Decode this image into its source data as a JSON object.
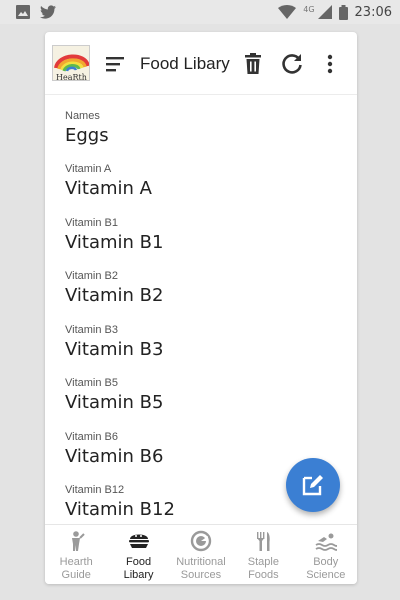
{
  "status_bar": {
    "network": "4G",
    "time": "23:06"
  },
  "toolbar": {
    "title": "Food Libary",
    "logo_text": "HeaRth"
  },
  "fields": [
    {
      "label": "Names",
      "value": "Eggs"
    },
    {
      "label": "Vitamin A",
      "value": "Vitamin A"
    },
    {
      "label": "Vitamin B1",
      "value": "Vitamin B1"
    },
    {
      "label": "Vitamin B2",
      "value": "Vitamin B2"
    },
    {
      "label": "Vitamin B3",
      "value": "Vitamin B3"
    },
    {
      "label": "Vitamin B5",
      "value": "Vitamin B5"
    },
    {
      "label": "Vitamin B6",
      "value": "Vitamin B6"
    },
    {
      "label": "Vitamin B12",
      "value": "Vitamin B12"
    }
  ],
  "bottom_nav": [
    {
      "label_line1": "Hearth",
      "label_line2": "Guide",
      "icon": "person-icon",
      "active": false
    },
    {
      "label_line1": "Food",
      "label_line2": "Libary",
      "icon": "food-bowl-icon",
      "active": true
    },
    {
      "label_line1": "Nutritional",
      "label_line2": "Sources",
      "icon": "nutrition-icon",
      "active": false
    },
    {
      "label_line1": "Staple",
      "label_line2": "Foods",
      "icon": "utensils-icon",
      "active": false
    },
    {
      "label_line1": "Body",
      "label_line2": "Science",
      "icon": "swimmer-icon",
      "active": false
    }
  ],
  "colors": {
    "fab": "#3b7fd3",
    "active_nav": "#222222",
    "inactive_nav": "#9a9a9a"
  }
}
